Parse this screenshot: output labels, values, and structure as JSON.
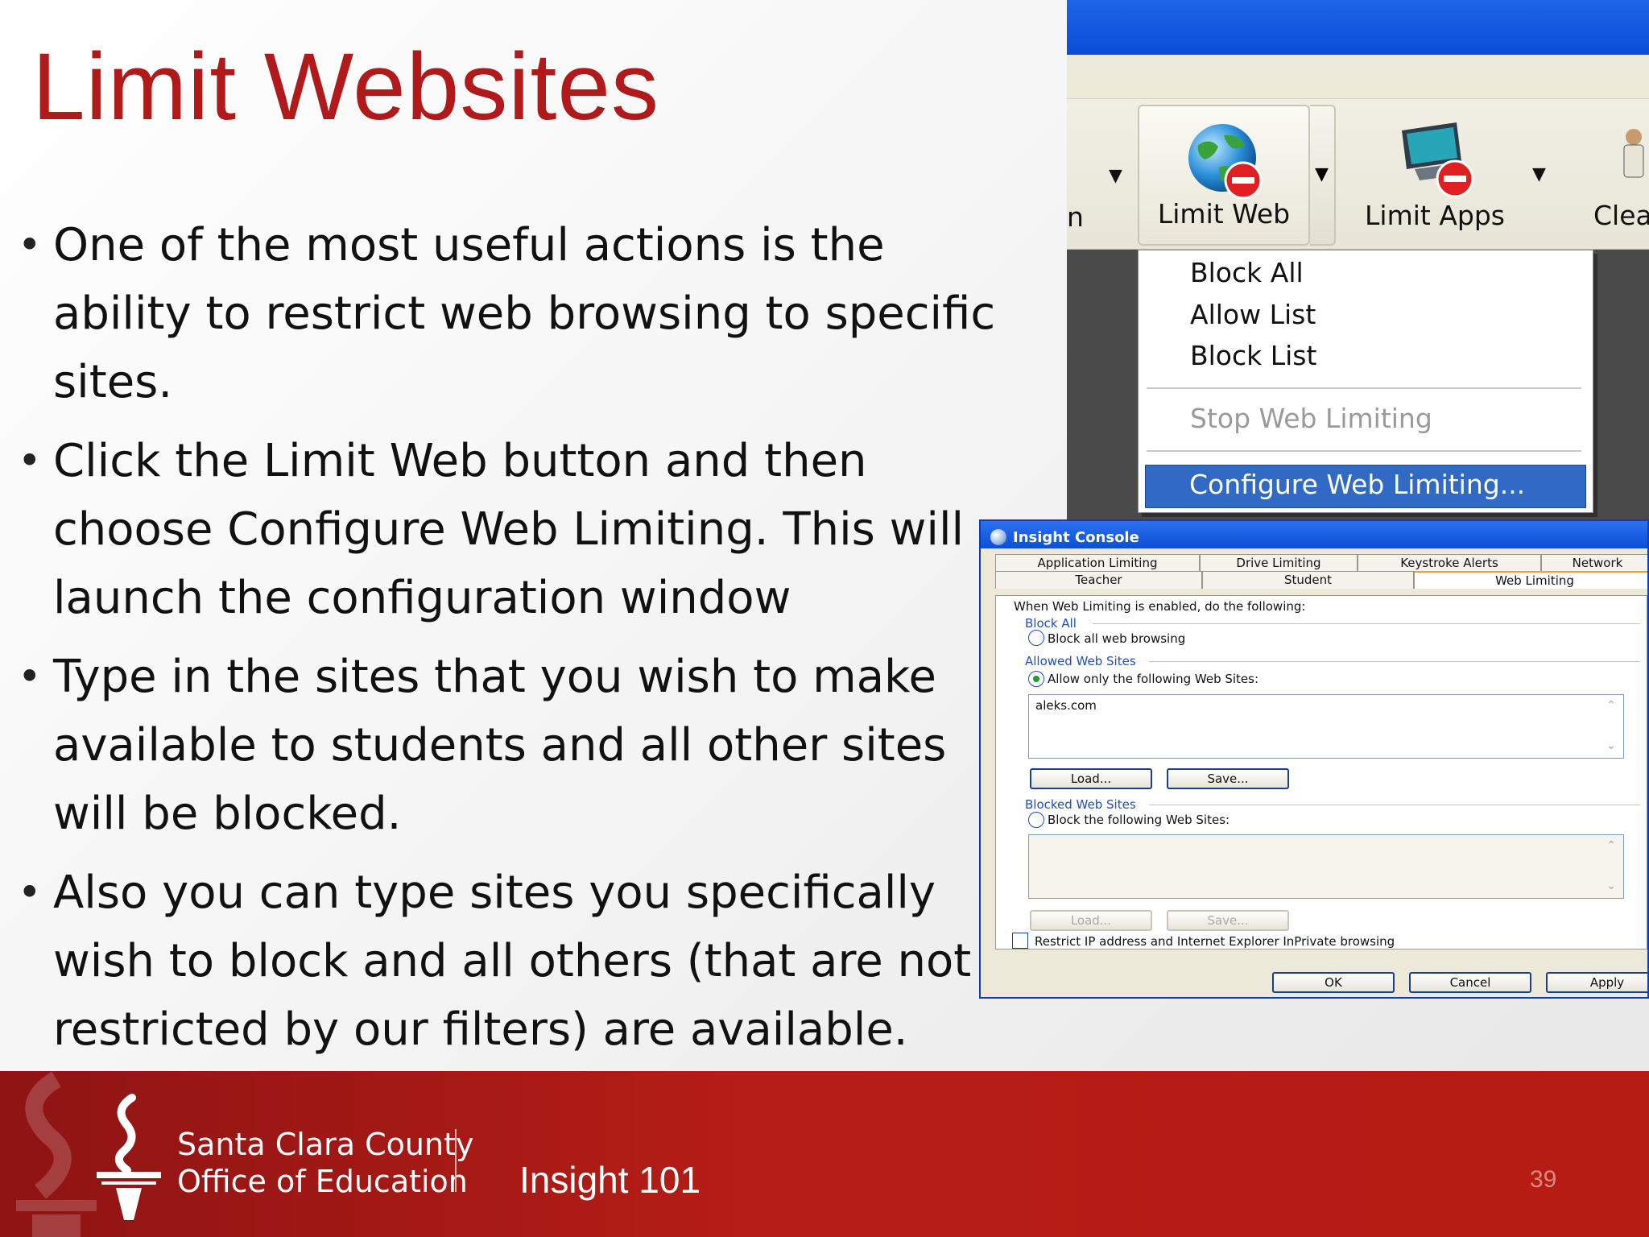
{
  "slide": {
    "title": "Limit Websites",
    "bullets": [
      "One of the most useful actions is the ability to restrict web browsing to specific sites.",
      "Click the Limit Web button and then choose Configure Web Limiting. This will launch the configuration window",
      "Type in the sites that you wish to make available to students and all other sites will be blocked.",
      "Also you can type sites you specifically wish to block and all others (that are not restricted by our filters) are available."
    ]
  },
  "toolbar": {
    "partial_left_label": "n",
    "buttons": [
      {
        "label": "Limit Web",
        "icon": "globe-no-entry-icon"
      },
      {
        "label": "Limit Apps",
        "icon": "monitor-no-entry-icon"
      },
      {
        "label": "Clear",
        "icon": "person-icon"
      }
    ],
    "menu": {
      "items": [
        "Block All",
        "Allow List",
        "Block List"
      ],
      "disabled_item": "Stop Web Limiting",
      "highlighted_item": "Configure Web Limiting..."
    }
  },
  "dialog": {
    "title": "Insight Console",
    "tabs_row1": [
      "Application Limiting",
      "Drive Limiting",
      "Keystroke Alerts",
      "Network"
    ],
    "tabs_row2": [
      "Teacher",
      "Student",
      "Web Limiting"
    ],
    "intro": "When Web Limiting is enabled, do the following:",
    "block_all_group": "Block All",
    "block_all_option": "Block all web browsing",
    "allowed_group": "Allowed Web Sites",
    "allowed_option": "Allow only the following Web Sites:",
    "allowed_sites": "aleks.com",
    "load_label": "Load...",
    "save_label": "Save...",
    "blocked_group": "Blocked Web Sites",
    "blocked_option": "Block the following Web Sites:",
    "restrict_label": "Restrict IP address and Internet Explorer InPrivate browsing",
    "ok_label": "OK",
    "cancel_label": "Cancel",
    "apply_label": "Apply"
  },
  "footer": {
    "org_line1": "Santa Clara County",
    "org_line2": "Office of Education",
    "course": "Insight 101",
    "page_number": "39"
  },
  "colors": {
    "title_red": "#b01a1a",
    "footer_red": "#b51d16",
    "menu_highlight": "#316ac5",
    "xp_titlebar": "#0b4fd6"
  }
}
